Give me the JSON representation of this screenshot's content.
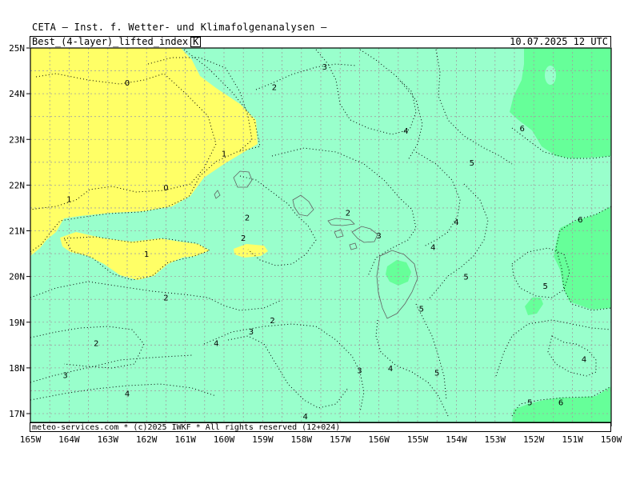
{
  "header": {
    "title": "CETA — Inst. f. Wetter- und Klimafolgenanalysen —"
  },
  "infobar": {
    "parameter": "Best_(4-layer)_lifted_index",
    "unit": "K",
    "valid_time": "10.07.2025 12 UTC"
  },
  "footer": {
    "text": "meteo-services.com * (c)2025 IWKF * All rights reserved (12+024)"
  },
  "map": {
    "lat_labels": [
      "25N",
      "24N",
      "23N",
      "22N",
      "21N",
      "20N",
      "19N",
      "18N",
      "17N"
    ],
    "lon_labels": [
      "165W",
      "164W",
      "163W",
      "162W",
      "161W",
      "160W",
      "159W",
      "158W",
      "157W",
      "156W",
      "155W",
      "154W",
      "153W",
      "152W",
      "151W",
      "150W"
    ],
    "contour_labels": [
      {
        "text": "0",
        "lon": -162.5,
        "lat": 24.25
      },
      {
        "text": "0",
        "lon": -161.5,
        "lat": 21.95
      },
      {
        "text": "1",
        "lon": -160.0,
        "lat": 22.7
      },
      {
        "text": "1",
        "lon": -164.0,
        "lat": 21.7
      },
      {
        "text": "1",
        "lon": -162.0,
        "lat": 20.5
      },
      {
        "text": "2",
        "lon": -158.7,
        "lat": 24.15
      },
      {
        "text": "3",
        "lon": -157.4,
        "lat": 24.6
      },
      {
        "text": "4",
        "lon": -155.3,
        "lat": 23.2
      },
      {
        "text": "5",
        "lon": -153.6,
        "lat": 22.5
      },
      {
        "text": "6",
        "lon": -152.3,
        "lat": 23.25
      },
      {
        "text": "6",
        "lon": -150.8,
        "lat": 21.25
      },
      {
        "text": "2",
        "lon": -159.4,
        "lat": 21.3
      },
      {
        "text": "2",
        "lon": -159.5,
        "lat": 20.85
      },
      {
        "text": "2",
        "lon": -156.8,
        "lat": 21.4
      },
      {
        "text": "3",
        "lon": -156.0,
        "lat": 20.9
      },
      {
        "text": "4",
        "lon": -154.0,
        "lat": 21.2
      },
      {
        "text": "4",
        "lon": -154.6,
        "lat": 20.65
      },
      {
        "text": "5",
        "lon": -153.75,
        "lat": 20.0
      },
      {
        "text": "5",
        "lon": -151.7,
        "lat": 19.8
      },
      {
        "text": "5",
        "lon": -154.9,
        "lat": 19.3
      },
      {
        "text": "2",
        "lon": -161.5,
        "lat": 19.55
      },
      {
        "text": "2",
        "lon": -158.75,
        "lat": 19.05
      },
      {
        "text": "3",
        "lon": -159.3,
        "lat": 18.8
      },
      {
        "text": "2",
        "lon": -163.3,
        "lat": 18.55
      },
      {
        "text": "4",
        "lon": -160.2,
        "lat": 18.55
      },
      {
        "text": "3",
        "lon": -164.1,
        "lat": 17.85
      },
      {
        "text": "4",
        "lon": -162.5,
        "lat": 17.45
      },
      {
        "text": "3",
        "lon": -156.5,
        "lat": 17.95
      },
      {
        "text": "4",
        "lon": -155.7,
        "lat": 18.0
      },
      {
        "text": "5",
        "lon": -154.5,
        "lat": 17.9
      },
      {
        "text": "4",
        "lon": -157.9,
        "lat": 16.95
      },
      {
        "text": "4",
        "lon": -150.7,
        "lat": 18.2
      },
      {
        "text": "5",
        "lon": -152.1,
        "lat": 17.25
      },
      {
        "text": "6",
        "lon": -151.3,
        "lat": 17.25
      }
    ],
    "colors": {
      "lifted_index_0_to_2": "#ffff66",
      "lifted_index_2_to_6": "#99ffcc",
      "lifted_index_6_plus": "#66ff99",
      "coast": "#606060",
      "grid": "#a0a0a0"
    }
  }
}
